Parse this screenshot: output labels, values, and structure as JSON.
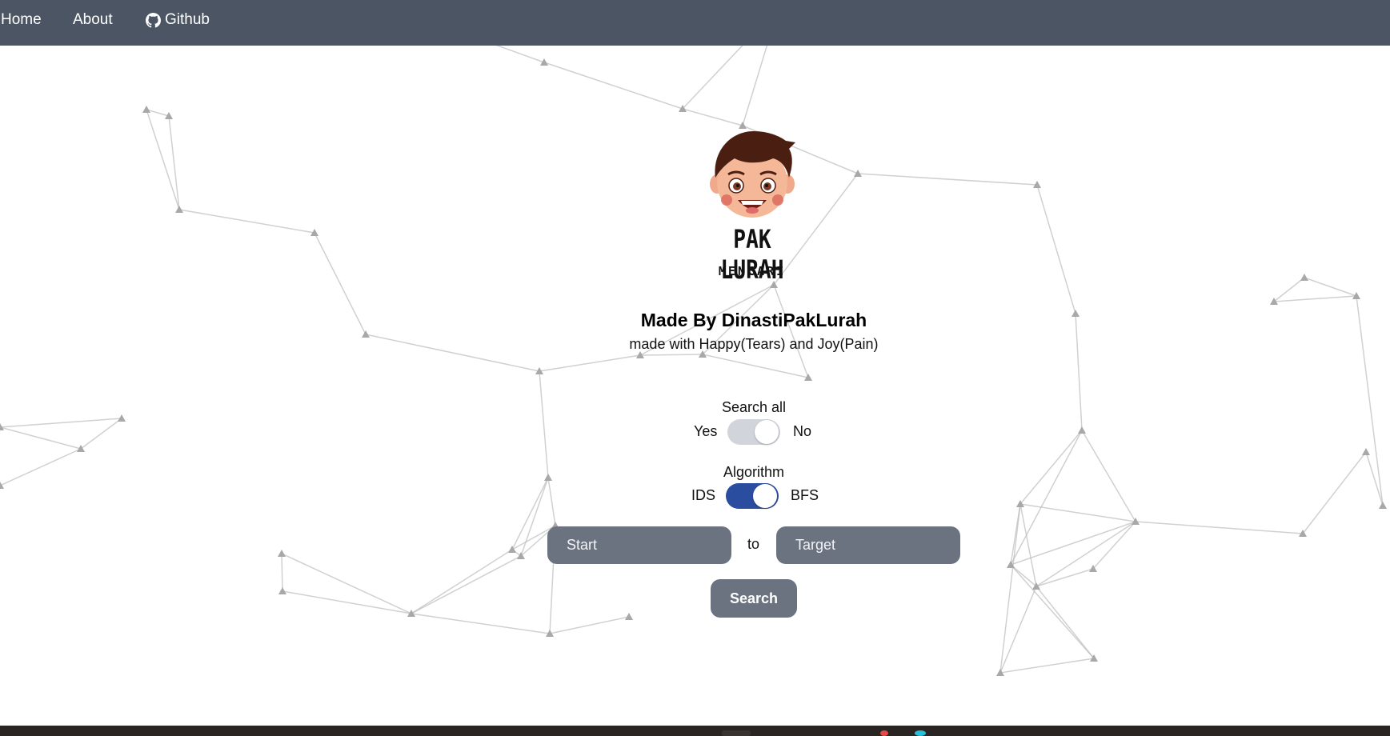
{
  "nav": {
    "home": "Home",
    "about": "About",
    "github": "Github"
  },
  "logo": {
    "title": "PAK LURAH",
    "subtitle": "MENCARI"
  },
  "credits": {
    "made_by": "Made By DinastiPakLurah",
    "made_with": "made with Happy(Tears) and Joy(Pain)"
  },
  "search_all": {
    "label": "Search all",
    "left": "Yes",
    "right": "No",
    "state": "off"
  },
  "algorithm": {
    "label": "Algorithm",
    "left": "IDS",
    "right": "BFS",
    "state": "on"
  },
  "form": {
    "start_placeholder": "Start",
    "to": "to",
    "target_placeholder": "Target",
    "search_button": "Search"
  },
  "colors": {
    "navbar": "#4b5563",
    "input": "#6b7280",
    "toggle_on": "#2b4da0",
    "toggle_off": "#d1d5db",
    "taskbar": "#2a2522"
  }
}
